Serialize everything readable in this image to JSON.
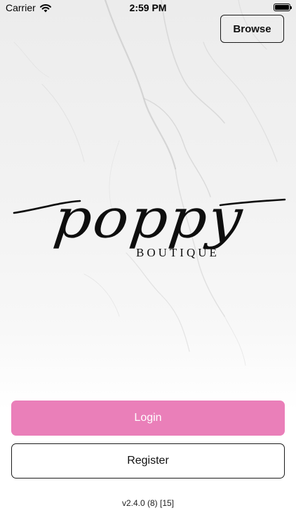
{
  "status_bar": {
    "carrier": "Carrier",
    "time": "2:59 PM",
    "wifi_icon": "wifi-icon",
    "battery_icon": "battery-icon",
    "battery_level": 1.0
  },
  "header": {
    "browse_label": "Browse"
  },
  "logo": {
    "word": "poppy",
    "subtitle": "BOUTIQUE"
  },
  "actions": {
    "login_label": "Login",
    "register_label": "Register"
  },
  "footer": {
    "version": "v2.4.0 (8) [15]"
  },
  "colors": {
    "login_button": "#ea7fb9",
    "text": "#111111",
    "background": "#ffffff"
  }
}
